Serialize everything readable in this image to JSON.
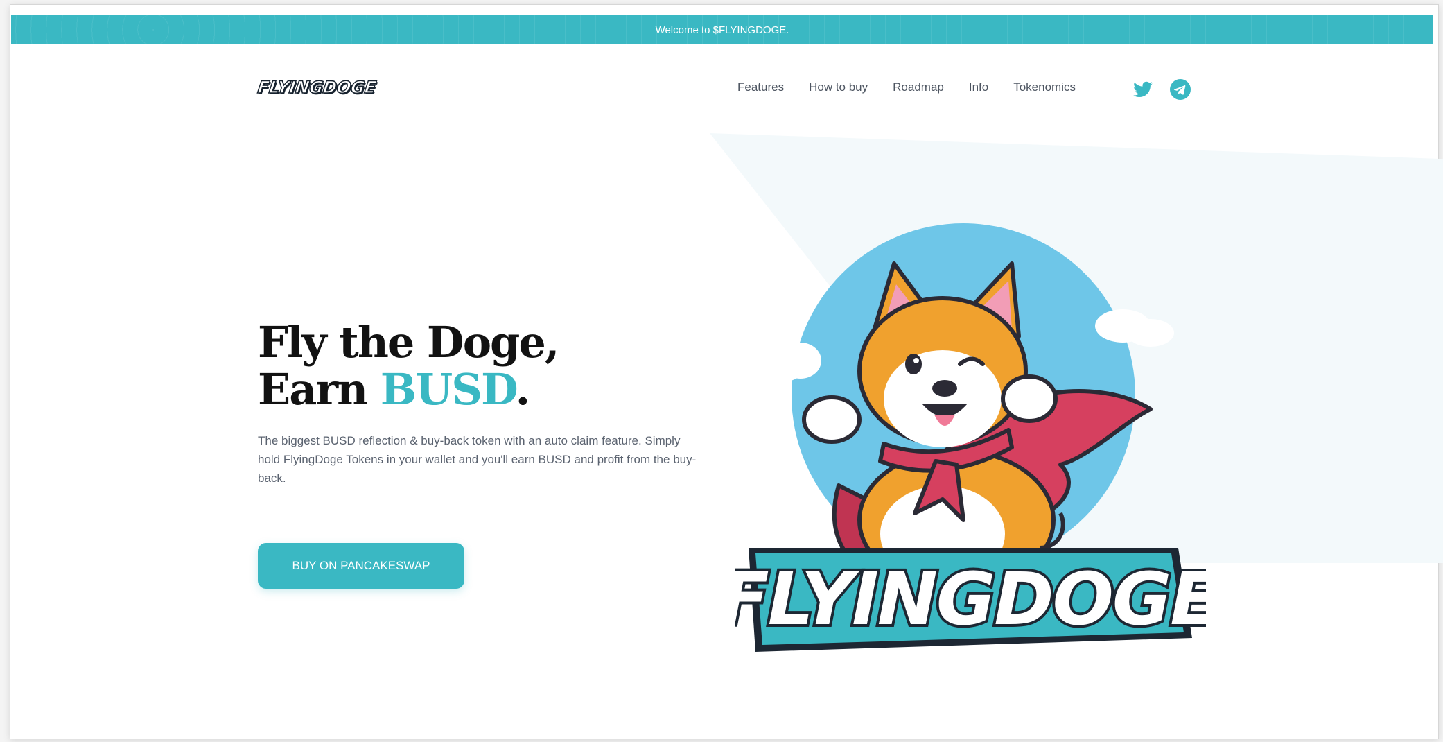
{
  "announcement": {
    "text": "Welcome to $FLYINGDOGE."
  },
  "header": {
    "logo_text": "FLYINGDOGE",
    "nav": [
      {
        "label": "Features"
      },
      {
        "label": "How to buy"
      },
      {
        "label": "Roadmap"
      },
      {
        "label": "Info"
      },
      {
        "label": "Tokenomics"
      }
    ],
    "social": [
      {
        "icon": "twitter-icon"
      },
      {
        "icon": "telegram-icon"
      }
    ]
  },
  "hero": {
    "title_line1": "Fly the Doge,",
    "title_line2_prefix": "Earn ",
    "title_line2_accent": "BUSD",
    "title_line2_suffix": ".",
    "description": "The biggest BUSD reflection & buy-back token with an auto claim feature. Simply hold FlyingDoge Tokens in your wallet and you'll earn BUSD and profit from the buy-back.",
    "cta_label": "BUY ON PANCAKESWAP",
    "mascot_logo_text": "FLYINGDOGE"
  },
  "colors": {
    "accent": "#3ab8c3",
    "dark_text": "#121212",
    "body_text": "#5b6370",
    "hero_background": "#f3f9fb",
    "mascot_sky": "#6ec6e8",
    "cape": "#d6405f",
    "fur": "#f0a12e"
  }
}
